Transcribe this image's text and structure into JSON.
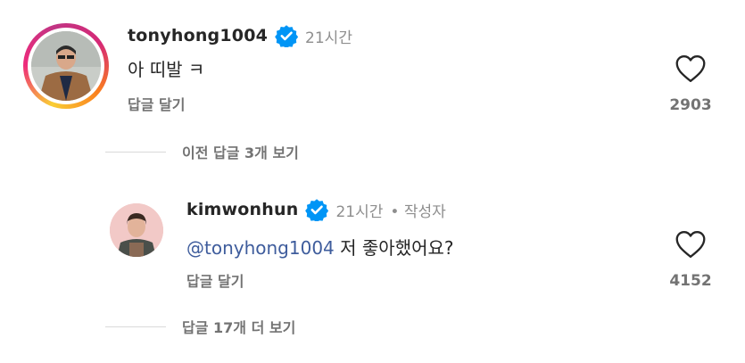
{
  "comments": [
    {
      "username": "tonyhong1004",
      "time": "21시간",
      "text": "아 띠발 ㅋ",
      "reply_label": "답글 달기",
      "likes": "2903",
      "has_story_ring": true
    },
    {
      "username": "kimwonhun",
      "time": "21시간",
      "author_badge": "• 작성자",
      "mention": "@tonyhong1004",
      "text": "저 좋아했어요?",
      "reply_label": "답글 달기",
      "likes": "4152"
    }
  ],
  "view_more": [
    "이전 답글 3개 보기",
    "답글 17개 더 보기"
  ],
  "colors": {
    "verified": "#0095f6",
    "mention": "#3e5c9c",
    "muted": "#737373"
  },
  "icons": [
    "verified-badge-icon",
    "heart-icon"
  ]
}
